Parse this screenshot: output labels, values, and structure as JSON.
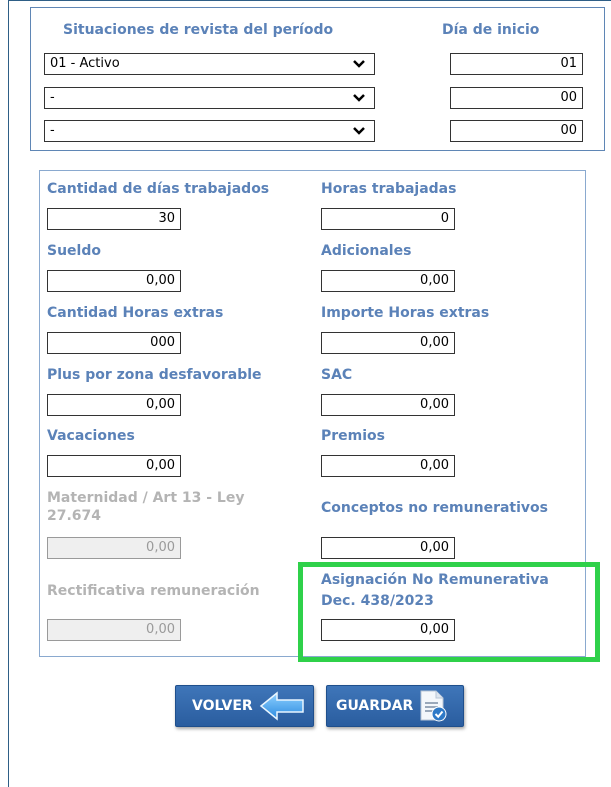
{
  "situaciones": {
    "header": "Situaciones de revista del período",
    "dia_header": "Día de inicio",
    "rows": [
      {
        "value": "01 - Activo",
        "dia": "01"
      },
      {
        "value": "-",
        "dia": "00"
      },
      {
        "value": "-",
        "dia": "00"
      }
    ]
  },
  "fields": {
    "dias_trabajados": {
      "label": "Cantidad de días trabajados",
      "value": "30"
    },
    "horas_trabajadas": {
      "label": "Horas trabajadas",
      "value": "0"
    },
    "sueldo": {
      "label": "Sueldo",
      "value": "0,00"
    },
    "adicionales": {
      "label": "Adicionales",
      "value": "0,00"
    },
    "cant_horas_extras": {
      "label": "Cantidad Horas extras",
      "value": "000"
    },
    "importe_horas_extras": {
      "label": "Importe Horas extras",
      "value": "0,00"
    },
    "plus_zona": {
      "label": "Plus por zona desfavorable",
      "value": "0,00"
    },
    "sac": {
      "label": "SAC",
      "value": "0,00"
    },
    "vacaciones": {
      "label": "Vacaciones",
      "value": "0,00"
    },
    "premios": {
      "label": "Premios",
      "value": "0,00"
    },
    "maternidad": {
      "label_line1": "Maternidad / Art 13 - Ley",
      "label_line2": "27.674",
      "value": "0,00"
    },
    "conceptos_no_rem": {
      "label": "Conceptos no remunerativos",
      "value": "0,00"
    },
    "rectificativa": {
      "label": "Rectificativa  remuneración",
      "value": "0,00"
    },
    "asignacion": {
      "label_line1": "Asignación No Remunerativa",
      "label_line2": "Dec. 438/2023",
      "value": "0,00"
    }
  },
  "buttons": {
    "volver": "VOLVER",
    "guardar": "GUARDAR"
  },
  "colors": {
    "label": "#5b82b8",
    "highlight": "#2fd14a",
    "button": "#3469ab"
  }
}
